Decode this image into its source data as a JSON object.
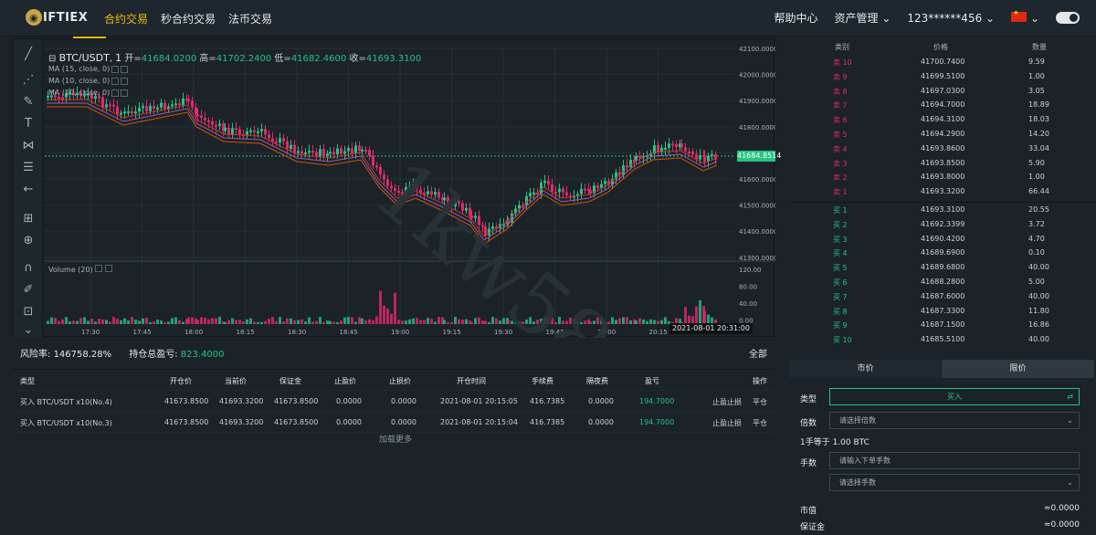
{
  "brand": "IFTIEX",
  "nav": [
    "合约交易",
    "秒合约交易",
    "法币交易"
  ],
  "topbar": {
    "help": "帮助中心",
    "assets": "资产管理",
    "user": "123******456"
  },
  "chart": {
    "pair": "BTC/USDT",
    "interval": "1",
    "open_label": "开=",
    "open": "41684.0200",
    "high_label": "高=",
    "high": "41702.2400",
    "low_label": "低=",
    "low": "41682.4600",
    "close_label": "收=",
    "close": "41693.3100",
    "ma": [
      "MA (15, close, 0)",
      "MA (10, close, 0)",
      "MA (20, close, 0)"
    ],
    "volume_label": "Volume (20)",
    "price_ticks": [
      "42100.0000",
      "42000.0000",
      "41900.0000",
      "41800.0000",
      "41700.0000",
      "41600.0000",
      "41500.0000",
      "41400.0000",
      "41300.0000"
    ],
    "volume_ticks": [
      "120.00",
      "80.00",
      "40.00",
      "0.00"
    ],
    "time_ticks": [
      "17:30",
      "17:45",
      "18:00",
      "18:15",
      "18:30",
      "18:45",
      "19:00",
      "19:15",
      "19:30",
      "19:45",
      "20:00",
      "20:15"
    ],
    "current_price": "41684.8514",
    "crosshair_time": "2021-08-01 20:31:00",
    "watermark": "1kw58"
  },
  "positions": {
    "risk_label": "风险率:",
    "risk_value": "146758.28%",
    "pnl_label": "持仓总盈亏:",
    "pnl_value": "823.4000",
    "all": "全部",
    "headers": [
      "类型",
      "开仓价",
      "当前价",
      "保证金",
      "止盈价",
      "止损价",
      "开仓时间",
      "手续费",
      "隔夜费",
      "盈亏",
      "操作"
    ],
    "rows": [
      {
        "type": "买入 BTC/USDT x10(No.4)",
        "open": "41673.8500",
        "current": "41693.3200",
        "margin": "41673.8500",
        "tp": "0.0000",
        "sl": "0.0000",
        "time": "2021-08-01 20:15:05",
        "fee": "416.7385",
        "overnight": "0.0000",
        "pnl": "194.7000",
        "act1": "止盈止损",
        "act2": "平仓"
      },
      {
        "type": "买入 BTC/USDT x10(No.3)",
        "open": "41673.8500",
        "current": "41693.3200",
        "margin": "41673.8500",
        "tp": "0.0000",
        "sl": "0.0000",
        "time": "2021-08-01 20:15:04",
        "fee": "416.7385",
        "overnight": "0.0000",
        "pnl": "194.7000",
        "act1": "止盈止损",
        "act2": "平仓"
      }
    ],
    "load_more": "加载更多"
  },
  "orderbook": {
    "headers": [
      "类别",
      "价格",
      "数量"
    ],
    "asks": [
      [
        "卖 10",
        "41700.7400",
        "9.59"
      ],
      [
        "卖 9",
        "41699.5100",
        "1.00"
      ],
      [
        "卖 8",
        "41697.0300",
        "3.05"
      ],
      [
        "卖 7",
        "41694.7000",
        "18.89"
      ],
      [
        "卖 6",
        "41694.3100",
        "18.03"
      ],
      [
        "卖 5",
        "41694.2900",
        "14.20"
      ],
      [
        "卖 4",
        "41693.8600",
        "33.04"
      ],
      [
        "卖 3",
        "41693.8500",
        "5.90"
      ],
      [
        "卖 2",
        "41693.8000",
        "1.00"
      ],
      [
        "卖 1",
        "41693.3200",
        "66.44"
      ]
    ],
    "bids": [
      [
        "买 1",
        "41693.3100",
        "20.55"
      ],
      [
        "买 2",
        "41692.3399",
        "3.72"
      ],
      [
        "买 3",
        "41690.4200",
        "4.70"
      ],
      [
        "买 4",
        "41689.6900",
        "0.10"
      ],
      [
        "买 5",
        "41689.6800",
        "40.00"
      ],
      [
        "买 6",
        "41688.2800",
        "5.00"
      ],
      [
        "买 7",
        "41687.6000",
        "40.00"
      ],
      [
        "买 8",
        "41687.3300",
        "11.80"
      ],
      [
        "买 9",
        "41687.1500",
        "16.86"
      ],
      [
        "买 10",
        "41685.5100",
        "40.00"
      ]
    ]
  },
  "form": {
    "tab_market": "市价",
    "tab_limit": "限价",
    "type_label": "类型",
    "type_value": "买入",
    "leverage_label": "倍数",
    "leverage_placeholder": "请选择倍数",
    "lot_note": "1手等于 1.00 BTC",
    "lots_label": "手数",
    "lots_placeholder": "请输入下单手数",
    "lots_select": "请选择手数",
    "value_label": "市值",
    "value": "≈0.0000",
    "margin_label": "保证金",
    "margin": "≈0.0000"
  },
  "colors": {
    "up": "#26c281",
    "down": "#e0296f",
    "accent": "#f0b90b"
  }
}
